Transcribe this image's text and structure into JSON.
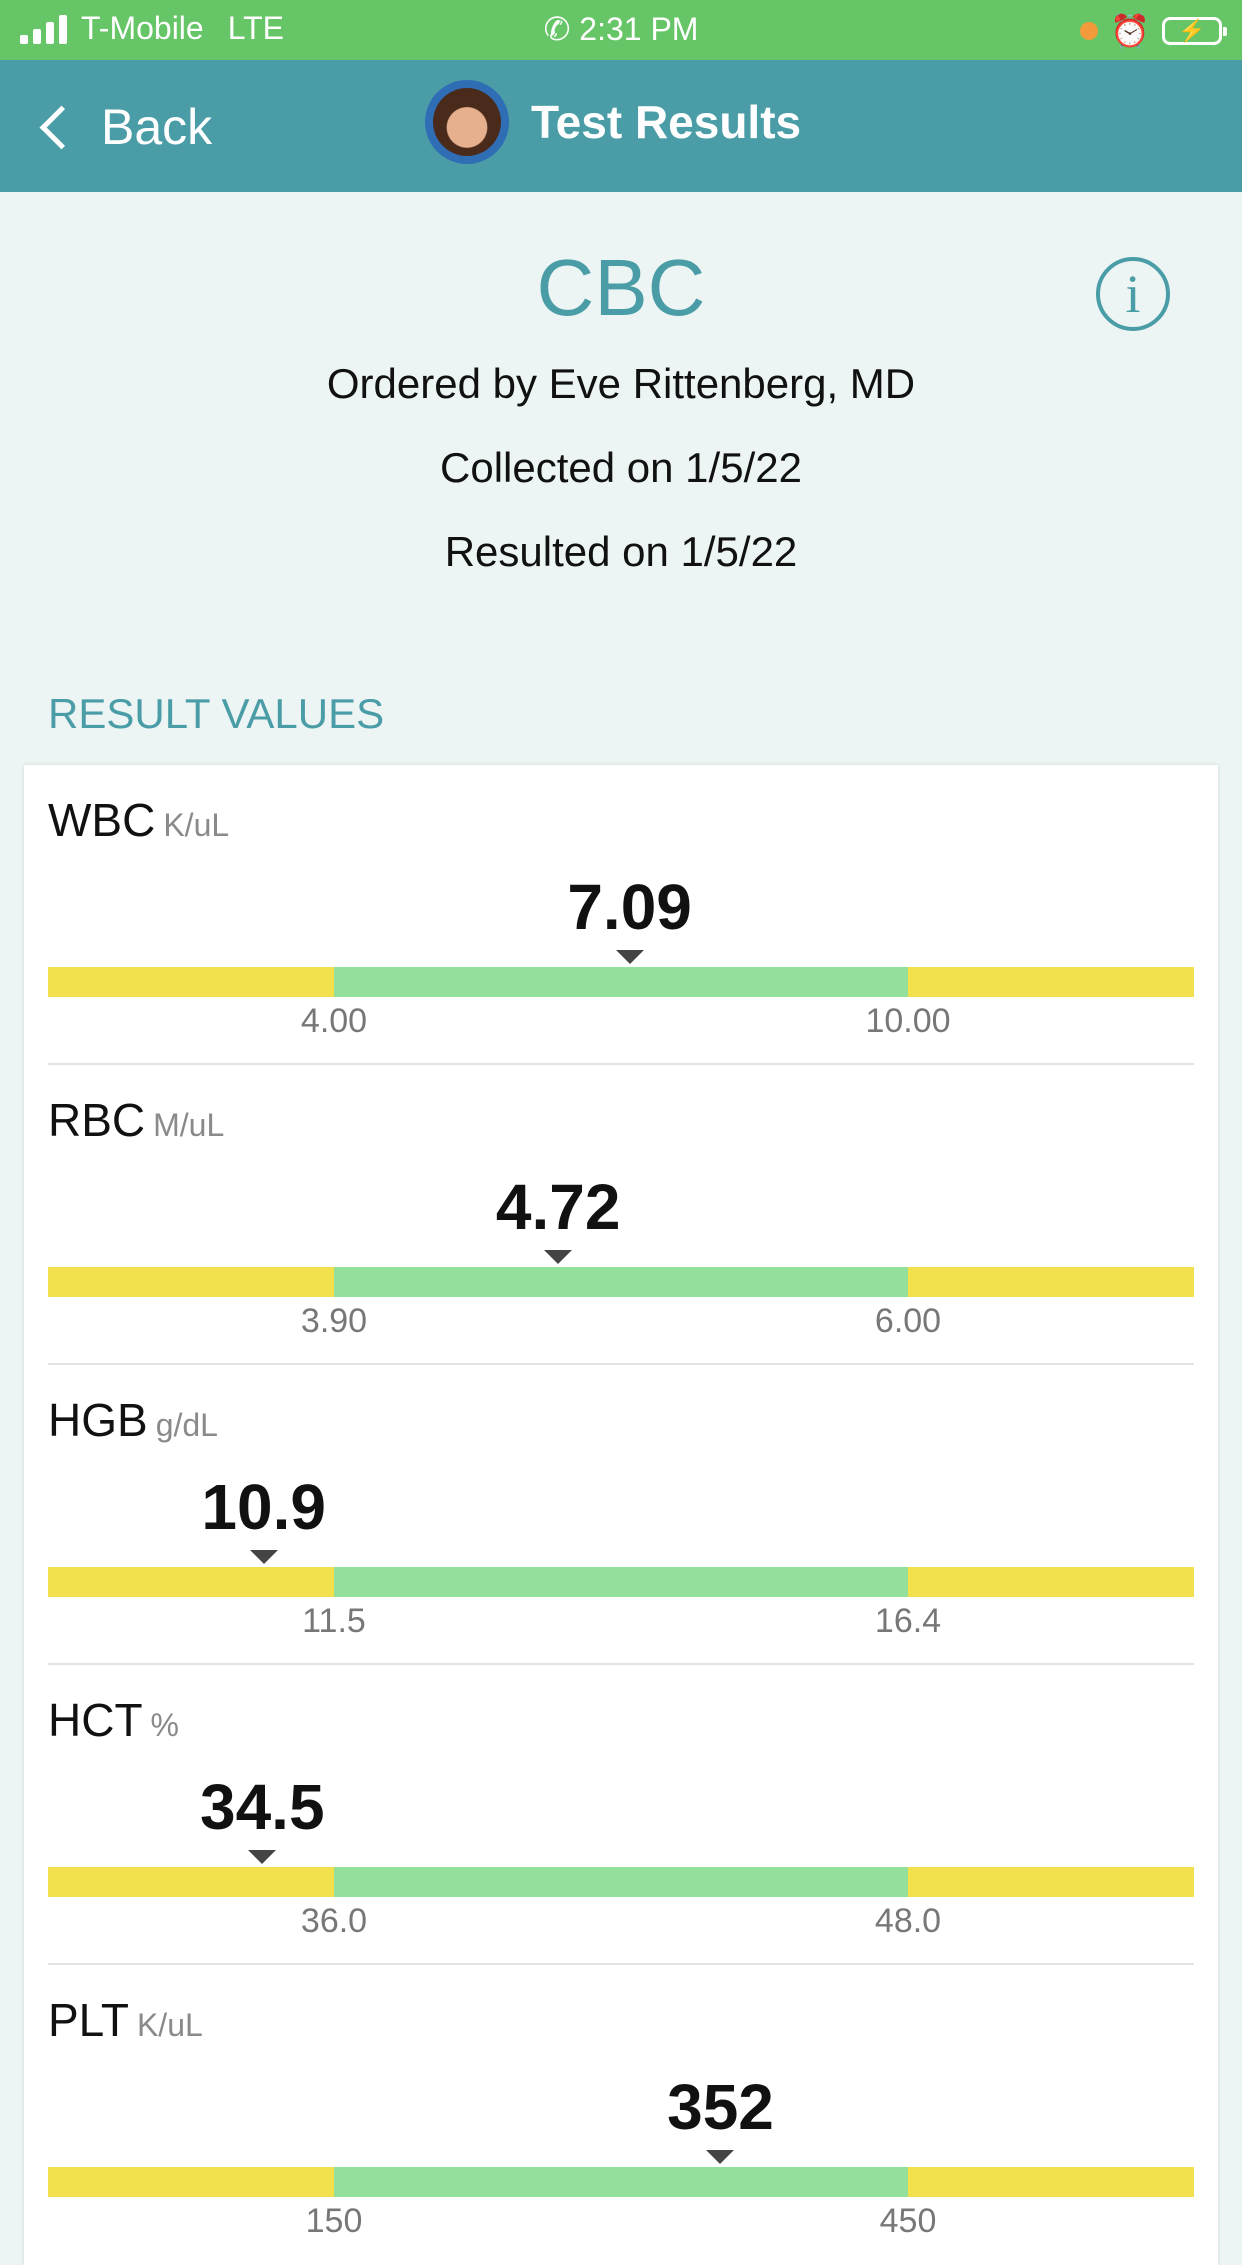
{
  "status_bar": {
    "carrier": "T-Mobile",
    "network": "LTE",
    "time": "2:31 PM"
  },
  "nav": {
    "back_label": "Back",
    "title": "Test Results"
  },
  "test": {
    "name": "CBC",
    "ordered_by": "Ordered by Eve Rittenberg, MD",
    "collected": "Collected on 1/5/22",
    "resulted": "Resulted on 1/5/22"
  },
  "section_header": "RESULT VALUES",
  "results": [
    {
      "name": "WBC",
      "unit": "K/uL",
      "value": "7.09",
      "low": "4.00",
      "high": "10.00",
      "value_num": 7.09,
      "low_num": 4.0,
      "high_num": 10.0
    },
    {
      "name": "RBC",
      "unit": "M/uL",
      "value": "4.72",
      "low": "3.90",
      "high": "6.00",
      "value_num": 4.72,
      "low_num": 3.9,
      "high_num": 6.0
    },
    {
      "name": "HGB",
      "unit": "g/dL",
      "value": "10.9",
      "low": "11.5",
      "high": "16.4",
      "value_num": 10.9,
      "low_num": 11.5,
      "high_num": 16.4
    },
    {
      "name": "HCT",
      "unit": "%",
      "value": "34.5",
      "low": "36.0",
      "high": "48.0",
      "value_num": 34.5,
      "low_num": 36.0,
      "high_num": 48.0
    },
    {
      "name": "PLT",
      "unit": "K/uL",
      "value": "352",
      "low": "150",
      "high": "450",
      "value_num": 352,
      "low_num": 150,
      "high_num": 450
    }
  ],
  "colors": {
    "status_bar": "#66c566",
    "nav_bar": "#4a9da6",
    "accent": "#4a9da6",
    "out_of_range": "#f2e14d",
    "in_range": "#94df9c"
  }
}
